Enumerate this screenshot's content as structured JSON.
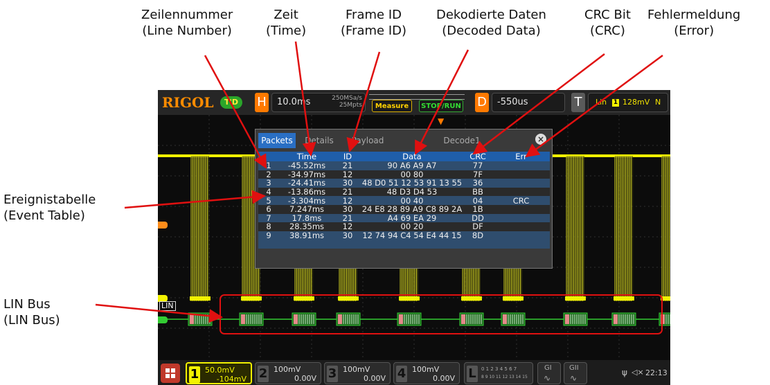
{
  "callouts": {
    "line_number": {
      "de": "Zeilennummer",
      "en": "(Line Number)"
    },
    "time": {
      "de": "Zeit",
      "en": "(Time)"
    },
    "frame_id": {
      "de": "Frame ID",
      "en": "(Frame ID)"
    },
    "decoded_data": {
      "de": "Dekodierte Daten",
      "en": "(Decoded Data)"
    },
    "crc": {
      "de": "CRC Bit",
      "en": "(CRC)"
    },
    "error": {
      "de": "Fehlermeldung",
      "en": "(Error)"
    },
    "event_table": {
      "de": "Ereignistabelle",
      "en": "(Event Table)"
    },
    "lin_bus": {
      "de": "LIN Bus",
      "en": "(LIN  Bus)"
    }
  },
  "scope": {
    "logo": "RIGOL",
    "run_mode": "T'D",
    "horizontal": {
      "letter": "H",
      "timebase": "10.0ms",
      "sample_rate": "250MSa/s",
      "memory_depth": "25Mpts"
    },
    "measure_label": "Measure",
    "stop_run_label": "STOP/RUN",
    "delay": {
      "letter": "D",
      "value": "-550us"
    },
    "trigger": {
      "letter": "T",
      "type": "Lin",
      "source": "1",
      "level": "128mV",
      "mode": "N"
    },
    "lin_label": "LIN",
    "channels": [
      {
        "num": "1",
        "scale": "50.0mV",
        "offset": "-104mV"
      },
      {
        "num": "2",
        "scale": "100mV",
        "offset": "0.00V"
      },
      {
        "num": "3",
        "scale": "100mV",
        "offset": "0.00V"
      },
      {
        "num": "4",
        "scale": "100mV",
        "offset": "0.00V"
      }
    ],
    "logic": {
      "letter": "L",
      "row1": "0 1 2 3  4 5 6 7",
      "row2": "8 9 10 11 12 13 14 15"
    },
    "gen1": "GI",
    "gen2": "GII",
    "clock": "22:13",
    "colors": {
      "ch1": "#f2f200",
      "lin": "#33cc33",
      "accent": "#ff7a00",
      "table_header": "#1f5ea9"
    }
  },
  "decode_dialog": {
    "tabs": [
      "Packets",
      "Details",
      "Payload",
      "Decode1"
    ],
    "columns": [
      "Time",
      "ID",
      "Data",
      "CRC",
      "Err"
    ],
    "rows": [
      [
        "1",
        "-45.52ms",
        "21",
        "90 A6 A9 A7",
        "77",
        ""
      ],
      [
        "2",
        "-34.97ms",
        "12",
        "00 80",
        "7F",
        ""
      ],
      [
        "3",
        "-24.41ms",
        "30",
        "48 D0 51 12 53 91 13 55",
        "36",
        ""
      ],
      [
        "4",
        "-13.86ms",
        "21",
        "48 D3 D4 53",
        "BB",
        ""
      ],
      [
        "5",
        "-3.304ms",
        "12",
        "00 40",
        "04",
        "CRC"
      ],
      [
        "6",
        "7.247ms",
        "30",
        "24 E8 28 89 A9 C8 89 2A",
        "1B",
        ""
      ],
      [
        "7",
        "17.8ms",
        "21",
        "A4 69 EA 29",
        "DD",
        ""
      ],
      [
        "8",
        "28.35ms",
        "12",
        "00 20",
        "DF",
        ""
      ],
      [
        "9",
        "38.91ms",
        "30",
        "12 74 94 C4 54 E4 44 15",
        "8D",
        ""
      ]
    ]
  }
}
